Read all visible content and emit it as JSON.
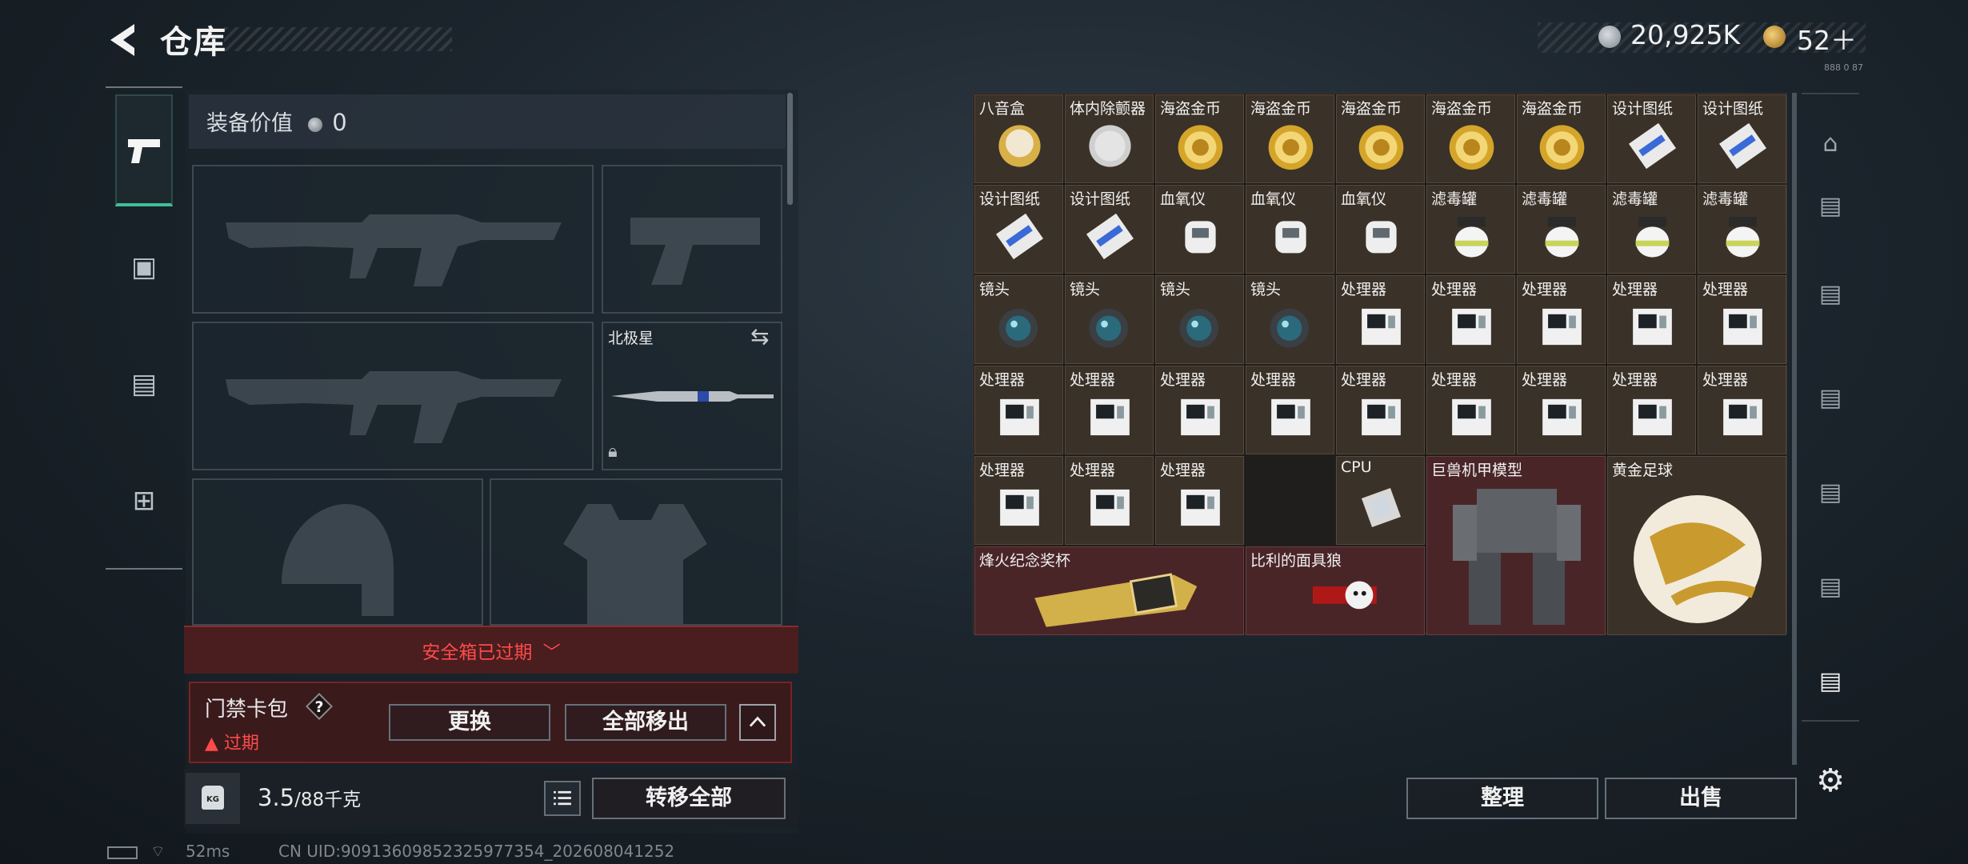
{
  "header": {
    "title": "仓库",
    "silver": "20,925K",
    "gold": "52＋"
  },
  "tiny_id": "888 0 87",
  "equip": {
    "value_label": "装备价值",
    "value": "0",
    "melee_name": "北极星"
  },
  "safebox": {
    "status": "安全箱已过期"
  },
  "card_pack": {
    "label": "门禁卡包",
    "help": "?",
    "status": "过期",
    "replace": "更换",
    "remove_all": "全部移出"
  },
  "bottom": {
    "kg_icon": "KG",
    "weight": "3.5",
    "capacity": "/88千克",
    "transfer_all": "转移全部"
  },
  "status_bar": {
    "ping": "52ms",
    "uid": "CN UID:9091360985232597735​4_202608041252"
  },
  "stash": {
    "cells": [
      {
        "label": "八音盒",
        "icon": "music-box"
      },
      {
        "label": "体内除颤器",
        "icon": "defibrillator"
      },
      {
        "label": "海盗金币",
        "icon": "gold-coin"
      },
      {
        "label": "海盗金币",
        "icon": "gold-coin"
      },
      {
        "label": "海盗金币",
        "icon": "gold-coin"
      },
      {
        "label": "海盗金币",
        "icon": "gold-coin"
      },
      {
        "label": "海盗金币",
        "icon": "gold-coin"
      },
      {
        "label": "设计图纸",
        "icon": "blueprint"
      },
      {
        "label": "设计图纸",
        "icon": "blueprint"
      },
      {
        "label": "设计图纸",
        "icon": "blueprint"
      },
      {
        "label": "设计图纸",
        "icon": "blueprint"
      },
      {
        "label": "血氧仪",
        "icon": "oximeter"
      },
      {
        "label": "血氧仪",
        "icon": "oximeter"
      },
      {
        "label": "血氧仪",
        "icon": "oximeter"
      },
      {
        "label": "滤毒罐",
        "icon": "filter"
      },
      {
        "label": "滤毒罐",
        "icon": "filter"
      },
      {
        "label": "滤毒罐",
        "icon": "filter"
      },
      {
        "label": "滤毒罐",
        "icon": "filter"
      },
      {
        "label": "镜头",
        "icon": "lens"
      },
      {
        "label": "镜头",
        "icon": "lens"
      },
      {
        "label": "镜头",
        "icon": "lens"
      },
      {
        "label": "镜头",
        "icon": "lens"
      },
      {
        "label": "处理器",
        "icon": "processor"
      },
      {
        "label": "处理器",
        "icon": "processor"
      },
      {
        "label": "处理器",
        "icon": "processor"
      },
      {
        "label": "处理器",
        "icon": "processor"
      },
      {
        "label": "处理器",
        "icon": "processor"
      },
      {
        "label": "处理器",
        "icon": "processor"
      },
      {
        "label": "处理器",
        "icon": "processor"
      },
      {
        "label": "处理器",
        "icon": "processor"
      },
      {
        "label": "处理器",
        "icon": "processor"
      },
      {
        "label": "处理器",
        "icon": "processor"
      },
      {
        "label": "处理器",
        "icon": "processor"
      },
      {
        "label": "处理器",
        "icon": "processor"
      },
      {
        "label": "处理器",
        "icon": "processor"
      },
      {
        "label": "处理器",
        "icon": "processor"
      },
      {
        "label": "处理器",
        "icon": "processor"
      },
      {
        "label": "处理器",
        "icon": "processor"
      },
      {
        "label": "处理器",
        "icon": "processor"
      },
      {
        "label": "CPU",
        "icon": "cpu"
      },
      {
        "label": "巨兽机甲模型",
        "icon": "mech-model"
      },
      {
        "label": "黄金足球",
        "icon": "gold-football"
      },
      {
        "label": "烽火纪念奖杯",
        "icon": "trophy"
      },
      {
        "label": "比利的面具狼",
        "icon": "billy-puppet"
      }
    ]
  },
  "actions": {
    "organize": "整理",
    "sell": "出售"
  }
}
